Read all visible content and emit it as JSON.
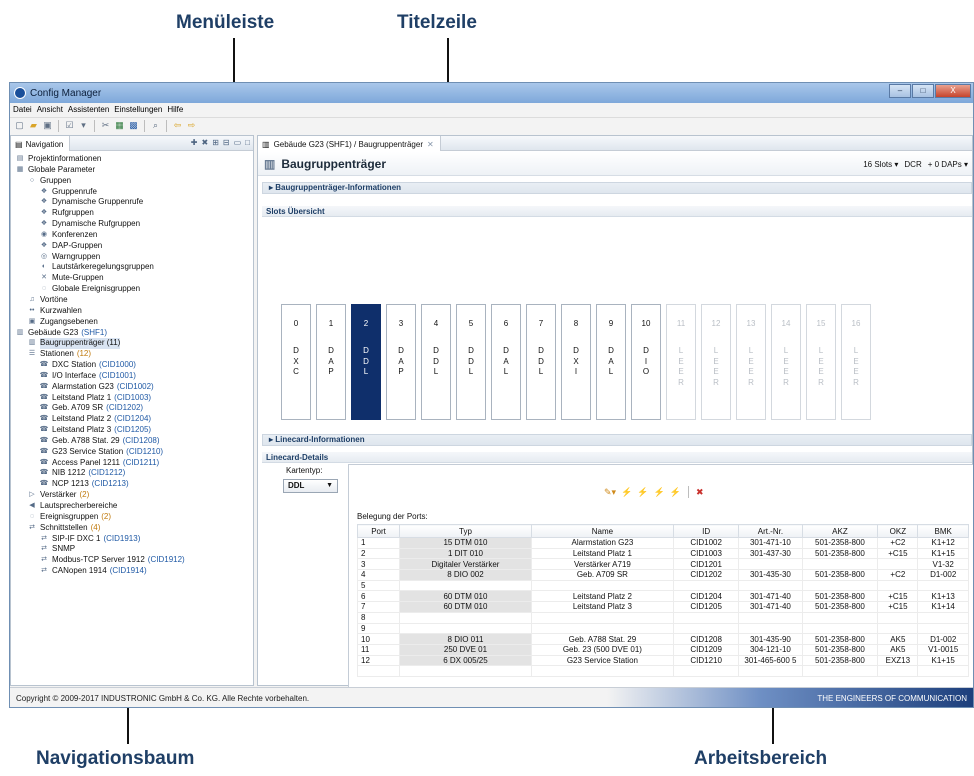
{
  "callouts": {
    "menu": "Menüleiste",
    "title": "Titelzeile",
    "nav": "Navigationsbaum",
    "work": "Arbeitsbereich"
  },
  "window": {
    "title": "Config Manager",
    "controls": [
      "–",
      "□",
      "X"
    ]
  },
  "menubar": [
    "Datei",
    "Ansicht",
    "Assistenten",
    "Einstellungen",
    "Hilfe"
  ],
  "toolbar_icons": [
    "new-file-icon",
    "open-folder-icon",
    "save-icon",
    "validate-icon",
    "dropdown-icon",
    "cut-icon",
    "grid-icon",
    "layout-icon",
    "search-icon",
    "back-icon",
    "forward-icon"
  ],
  "navigation": {
    "tab_label": "Navigation",
    "items": [
      {
        "label": "Projektinformationen",
        "level": 1,
        "icon": "document-icon"
      },
      {
        "label": "Globale Parameter",
        "level": 1,
        "icon": "settings-icon"
      },
      {
        "label": "Gruppen",
        "level": 2,
        "icon": "circle-icon"
      },
      {
        "label": "Gruppenrufe",
        "level": 3,
        "icon": "group-icon"
      },
      {
        "label": "Dynamische Gruppenrufe",
        "level": 3,
        "icon": "group-icon"
      },
      {
        "label": "Rufgruppen",
        "level": 3,
        "icon": "group-icon"
      },
      {
        "label": "Dynamische Rufgruppen",
        "level": 3,
        "icon": "group-icon"
      },
      {
        "label": "Konferenzen",
        "level": 3,
        "icon": "conference-icon"
      },
      {
        "label": "DAP-Gruppen",
        "level": 3,
        "icon": "group-icon"
      },
      {
        "label": "Warngruppen",
        "level": 3,
        "icon": "warning-icon"
      },
      {
        "label": "Lautstärkeregelungsgruppen",
        "level": 3,
        "icon": "volume-icon"
      },
      {
        "label": "Mute-Gruppen",
        "level": 3,
        "icon": "mute-icon"
      },
      {
        "label": "Globale Ereignisgruppen",
        "level": 3,
        "icon": "event-icon"
      },
      {
        "label": "Vortöne",
        "level": 2,
        "icon": "note-icon"
      },
      {
        "label": "Kurzwahlen",
        "level": 2,
        "icon": "dial-icon"
      },
      {
        "label": "Zugangsebenen",
        "level": 2,
        "icon": "lock-icon"
      },
      {
        "label": "Gebäude G23",
        "level": 1,
        "icon": "building-icon",
        "cid": "(SHF1)"
      },
      {
        "label": "Baugruppenträger (11)",
        "level": 2,
        "icon": "rack-icon",
        "selected": true
      },
      {
        "label": "Stationen",
        "level": 2,
        "icon": "stations-icon",
        "count": "(12)"
      },
      {
        "label": "DXC Station",
        "level": 3,
        "icon": "station-icon",
        "cid": "(CID1000)"
      },
      {
        "label": "I/O Interface",
        "level": 3,
        "icon": "station-icon",
        "cid": "(CID1001)"
      },
      {
        "label": "Alarmstation G23",
        "level": 3,
        "icon": "station-icon",
        "cid": "(CID1002)"
      },
      {
        "label": "Leitstand Platz 1",
        "level": 3,
        "icon": "station-icon",
        "cid": "(CID1003)"
      },
      {
        "label": "Geb. A709 SR",
        "level": 3,
        "icon": "station-icon",
        "cid": "(CID1202)"
      },
      {
        "label": "Leitstand Platz 2",
        "level": 3,
        "icon": "station-icon",
        "cid": "(CID1204)"
      },
      {
        "label": "Leitstand Platz 3",
        "level": 3,
        "icon": "station-icon",
        "cid": "(CID1205)"
      },
      {
        "label": "Geb. A788 Stat. 29",
        "level": 3,
        "icon": "station-icon",
        "cid": "(CID1208)"
      },
      {
        "label": "G23 Service Station",
        "level": 3,
        "icon": "station-icon",
        "cid": "(CID1210)"
      },
      {
        "label": "Access Panel 1211",
        "level": 3,
        "icon": "station-icon",
        "cid": "(CID1211)"
      },
      {
        "label": "NIB 1212",
        "level": 3,
        "icon": "station-icon",
        "cid": "(CID1212)"
      },
      {
        "label": "NCP 1213",
        "level": 3,
        "icon": "station-icon",
        "cid": "(CID1213)"
      },
      {
        "label": "Verstärker",
        "level": 2,
        "icon": "amplifier-icon",
        "count": "(2)"
      },
      {
        "label": "Lautsprecherbereiche",
        "level": 2,
        "icon": "speaker-icon"
      },
      {
        "label": "Ereignisgruppen",
        "level": 2,
        "icon": "event-icon",
        "count": "(2)"
      },
      {
        "label": "Schnittstellen",
        "level": 2,
        "icon": "interface-icon",
        "count": "(4)"
      },
      {
        "label": "SIP-IF DXC 1",
        "level": 3,
        "icon": "interface-icon",
        "cid": "(CID1913)"
      },
      {
        "label": "SNMP",
        "level": 3,
        "icon": "interface-icon"
      },
      {
        "label": "Modbus-TCP Server 1912",
        "level": 3,
        "icon": "interface-icon",
        "cid": "(CID1912)"
      },
      {
        "label": "CANopen 1914",
        "level": 3,
        "icon": "interface-icon",
        "cid": "(CID1914)"
      }
    ]
  },
  "editor": {
    "tab_label": "Gebäude G23 (SHF1) / Baugruppenträger",
    "page_title": "Baugruppenträger",
    "slots_select": "16 Slots",
    "dcr_select": "DCR",
    "daps_select": "+ 0 DAPs",
    "sections": {
      "info": "Baugruppenträger-Informationen",
      "slots": "Slots Übersicht",
      "linecard_info": "Linecard-Informationen",
      "linecard_details": "Linecard-Details"
    },
    "slots": [
      {
        "num": "0",
        "name": "D\nX\nC"
      },
      {
        "num": "1",
        "name": "D\nA\nP"
      },
      {
        "num": "2",
        "name": "D\nD\nL",
        "active": true
      },
      {
        "num": "3",
        "name": "D\nA\nP"
      },
      {
        "num": "4",
        "name": "D\nD\nL"
      },
      {
        "num": "5",
        "name": "D\nD\nL"
      },
      {
        "num": "6",
        "name": "D\nA\nL"
      },
      {
        "num": "7",
        "name": "D\nD\nL"
      },
      {
        "num": "8",
        "name": "D\nX\nI"
      },
      {
        "num": "9",
        "name": "D\nA\nL"
      },
      {
        "num": "10",
        "name": "D\nI\nO"
      },
      {
        "num": "11",
        "name": "L\nE\nE\nR",
        "empty": true
      },
      {
        "num": "12",
        "name": "L\nE\nE\nR",
        "empty": true
      },
      {
        "num": "13",
        "name": "L\nE\nE\nR",
        "empty": true
      },
      {
        "num": "14",
        "name": "L\nE\nE\nR",
        "empty": true
      },
      {
        "num": "15",
        "name": "L\nE\nE\nR",
        "empty": true
      },
      {
        "num": "16",
        "name": "L\nE\nE\nR",
        "empty": true
      }
    ],
    "kartentyp_label": "Kartentyp:",
    "kartentyp_value": "DDL",
    "belegung_label": "Belegung der Ports:",
    "ports_columns": [
      "Port",
      "Typ",
      "Name",
      "ID",
      "Art.-Nr.",
      "AKZ",
      "OKZ",
      "BMK"
    ],
    "ports_rows": [
      [
        "1",
        "15 DTM 010",
        "Alarmstation G23",
        "CID1002",
        "301-471-10",
        "501-2358-800",
        "+C2",
        "K1+12"
      ],
      [
        "2",
        "1 DIT 010",
        "Leitstand Platz 1",
        "CID1003",
        "301-437-30",
        "501-2358-800",
        "+C15",
        "K1+15"
      ],
      [
        "3",
        "Digitaler Verstärker",
        "Verstärker A719",
        "CID1201",
        "",
        "",
        "",
        "V1-32"
      ],
      [
        "4",
        "8 DIO 002",
        "Geb. A709 SR",
        "CID1202",
        "301-435-30",
        "501-2358-800",
        "+C2",
        "D1-002"
      ],
      [
        "5",
        "",
        "",
        "",
        "",
        "",
        "",
        ""
      ],
      [
        "6",
        "60 DTM 010",
        "Leitstand Platz 2",
        "CID1204",
        "301-471-40",
        "501-2358-800",
        "+C15",
        "K1+13"
      ],
      [
        "7",
        "60 DTM 010",
        "Leitstand Platz 3",
        "CID1205",
        "301-471-40",
        "501-2358-800",
        "+C15",
        "K1+14"
      ],
      [
        "8",
        "",
        "",
        "",
        "",
        "",
        "",
        ""
      ],
      [
        "9",
        "",
        "",
        "",
        "",
        "",
        "",
        ""
      ],
      [
        "10",
        "8 DIO 011",
        "Geb. A788 Stat. 29",
        "CID1208",
        "301-435-90",
        "501-2358-800",
        "AK5",
        "D1-002"
      ],
      [
        "11",
        "250 DVE 01",
        "Geb. 23 (500 DVE 01)",
        "CID1209",
        "304-121-10",
        "501-2358-800",
        "AK5",
        "V1-0015"
      ],
      [
        "12",
        "6 DX 005/25",
        "G23 Service Station",
        "CID1210",
        "301-465-600 5",
        "501-2358-800",
        "EXZ13",
        "K1+15"
      ]
    ]
  },
  "statusbar": {
    "copyright": "Copyright © 2009-2017 INDUSTRONIC GmbH & Co. KG. Alle Rechte vorbehalten.",
    "brand": "THE ENGINEERS OF COMMUNICATION"
  }
}
